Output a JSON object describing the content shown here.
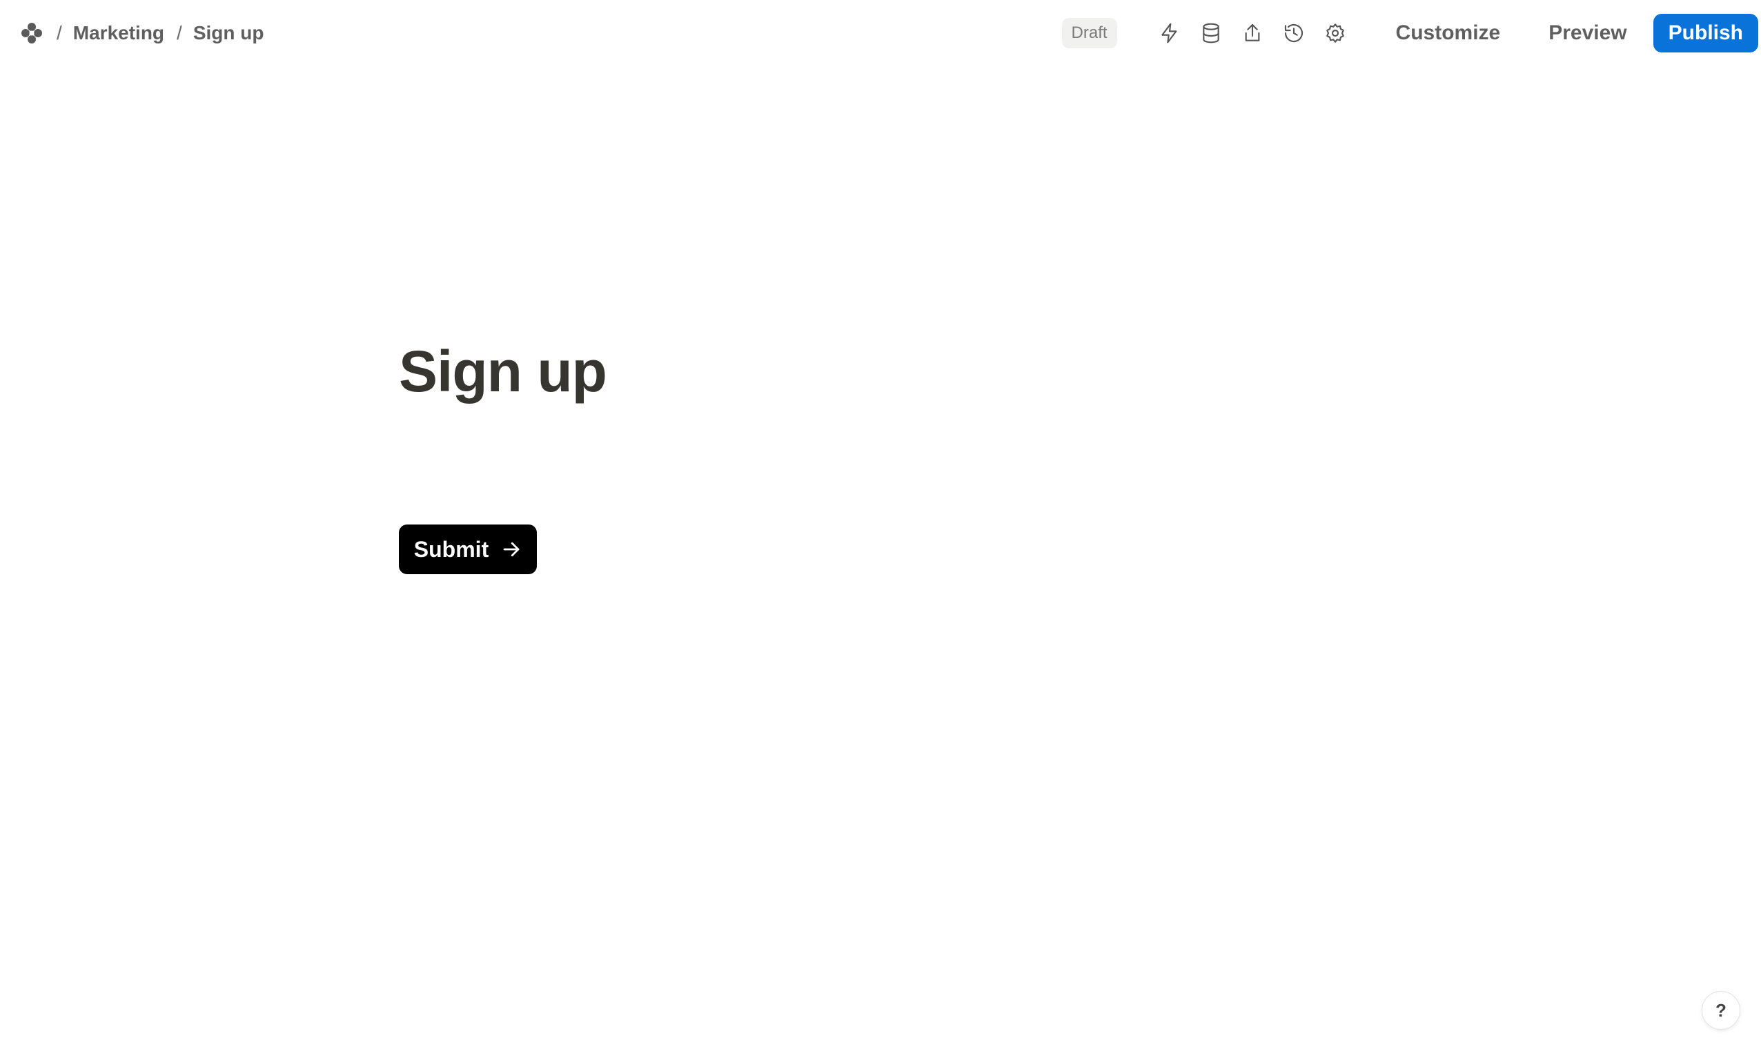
{
  "header": {
    "breadcrumb": {
      "separator": "/",
      "workspace": "Marketing",
      "page": "Sign up"
    },
    "status": "Draft",
    "icons": [
      "lightning-icon",
      "database-icon",
      "share-icon",
      "history-icon",
      "gear-icon"
    ],
    "customize_label": "Customize",
    "preview_label": "Preview",
    "publish_label": "Publish"
  },
  "form": {
    "title": "Sign up",
    "submit_label": "Submit"
  },
  "help": {
    "label": "?"
  },
  "colors": {
    "publish": "#0a73d9",
    "submit": "#000000",
    "title": "#37352f"
  }
}
